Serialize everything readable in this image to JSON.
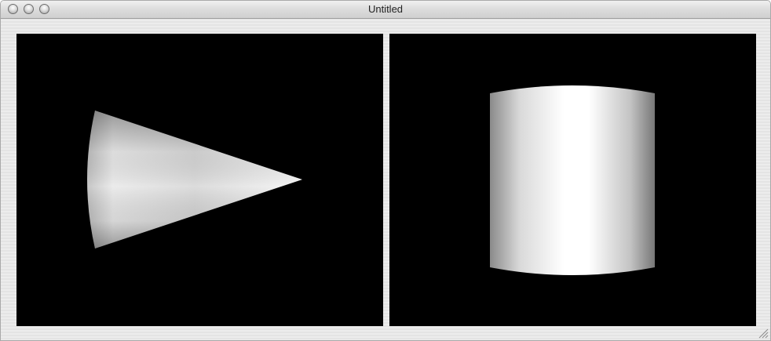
{
  "window": {
    "title": "Untitled"
  },
  "titlebar": {
    "buttons": [
      {
        "name": "close",
        "icon": "close-circle-icon"
      },
      {
        "name": "minimize",
        "icon": "minimize-circle-icon"
      },
      {
        "name": "zoom",
        "icon": "zoom-circle-icon"
      }
    ]
  },
  "viewports": [
    {
      "shape": "cone",
      "background": "#000000",
      "fill": "#ffffff"
    },
    {
      "shape": "cylinder",
      "background": "#000000",
      "fill": "#ffffff"
    }
  ],
  "resize_handle": {
    "icon": "resize-grip-icon"
  }
}
